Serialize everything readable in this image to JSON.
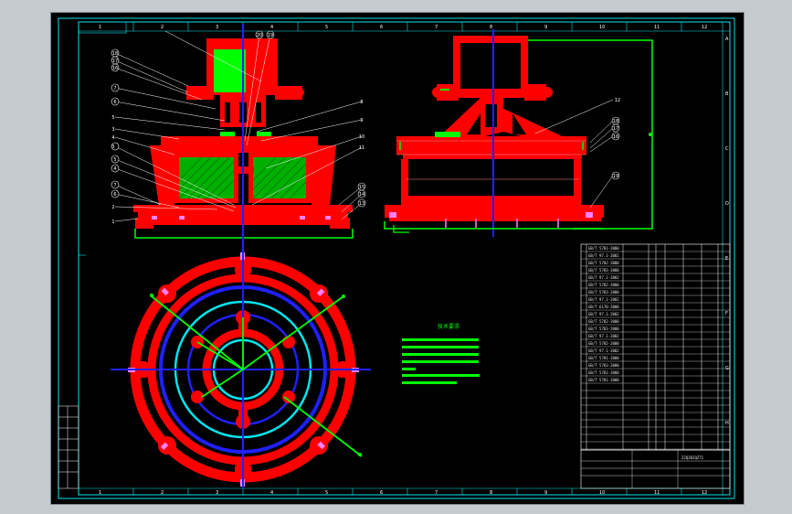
{
  "zone_numbers_top": [
    "1",
    "2",
    "3",
    "4",
    "5",
    "6",
    "7",
    "8",
    "9",
    "10",
    "11",
    "12"
  ],
  "zone_numbers_bottom": [
    "1",
    "2",
    "3",
    "4",
    "5",
    "6",
    "7",
    "8",
    "9",
    "10",
    "11",
    "12"
  ],
  "zone_letters_right": [
    "A",
    "B",
    "C",
    "D",
    "E",
    "F",
    "G",
    "H"
  ],
  "front_view_callouts_left": [
    "18",
    "17",
    "16",
    "7",
    "6",
    "5",
    "3",
    "4",
    "3",
    "5",
    "4",
    "7",
    "6",
    "2",
    "1"
  ],
  "front_view_callouts_right": [
    "20",
    "19",
    "8",
    "9",
    "10",
    "11",
    "15",
    "14",
    "13"
  ],
  "side_view_callouts": [
    "12",
    "18",
    "17",
    "16",
    "19"
  ],
  "bom_codes": [
    "GB/T 5781-2000",
    "GB/T 97.1-2002",
    "GB/T 5782-2000",
    "GB/T 5783-2000",
    "GB/T 97.1-2002",
    "GB/T 5782-2000",
    "GB/T 5783-2000",
    "GB/T 97.1-2002",
    "GB/T 6170-2000",
    "GB/T 97.1-2002",
    "GB/T 5782-2000",
    "GB/T 5783-2000",
    "GB/T 97.1-2002",
    "GB/T 5782-2000",
    "GB/T 97.1-2002",
    "GB/T 5781-2000",
    "GB/T 5783-2000",
    "GB/T 5781-2000",
    "GB/T 5781-2000"
  ],
  "title_block_code": "ZJQZ8JQZ71",
  "tech_req_title": "技术要求"
}
